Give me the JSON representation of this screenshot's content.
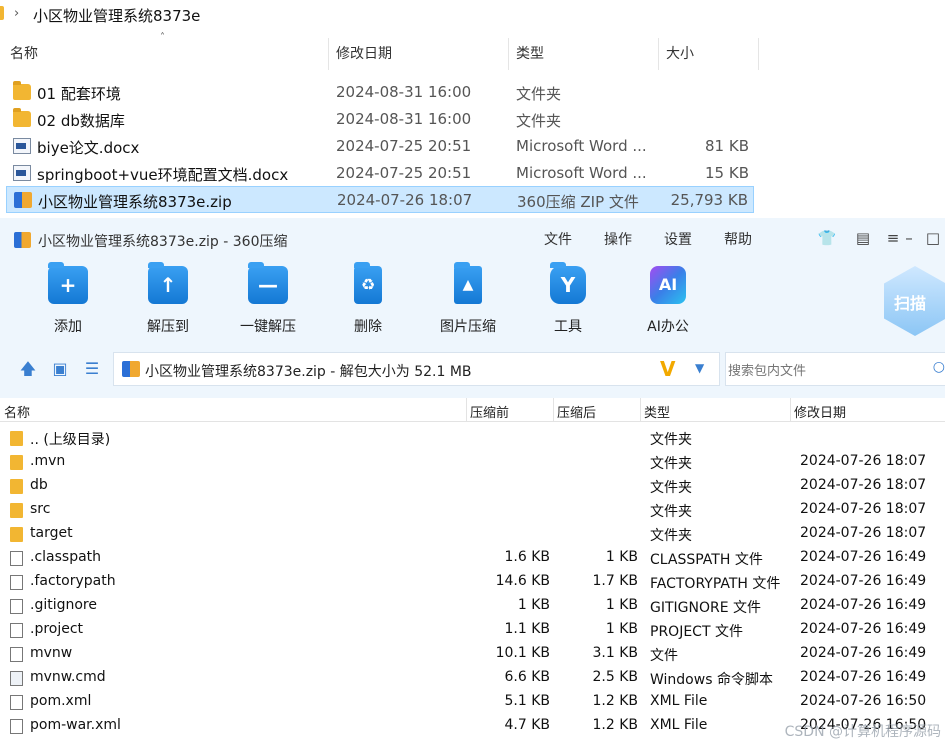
{
  "explorer": {
    "path": "小区物业管理系统8373e",
    "columns": {
      "name": "名称",
      "modified": "修改日期",
      "type": "类型",
      "size": "大小"
    },
    "rows": [
      {
        "name": "01 配套环境",
        "modified": "2024-08-31 16:00",
        "type": "文件夹",
        "size": "",
        "icon": "folder-icon"
      },
      {
        "name": "02 db数据库",
        "modified": "2024-08-31 16:00",
        "type": "文件夹",
        "size": "",
        "icon": "folder-icon"
      },
      {
        "name": "biye论文.docx",
        "modified": "2024-07-25 20:51",
        "type": "Microsoft Word ...",
        "size": "81 KB",
        "icon": "word-doc-icon"
      },
      {
        "name": "springboot+vue环境配置文档.docx",
        "modified": "2024-07-25 20:51",
        "type": "Microsoft Word ...",
        "size": "15 KB",
        "icon": "word-doc-icon"
      },
      {
        "name": "小区物业管理系统8373e.zip",
        "modified": "2024-07-26 18:07",
        "type": "360压缩 ZIP 文件",
        "size": "25,793 KB",
        "icon": "zip-icon"
      }
    ]
  },
  "zip_window": {
    "title": "小区物业管理系统8373e.zip - 360压缩",
    "menu": [
      "文件",
      "操作",
      "设置",
      "帮助"
    ],
    "toolbar": [
      {
        "label": "添加",
        "icon": "add-icon"
      },
      {
        "label": "解压到",
        "icon": "extract-to-icon"
      },
      {
        "label": "一键解压",
        "icon": "one-click-extract-icon"
      },
      {
        "label": "删除",
        "icon": "delete-icon"
      },
      {
        "label": "图片压缩",
        "icon": "image-compress-icon"
      },
      {
        "label": "工具",
        "icon": "tools-icon"
      },
      {
        "label": "AI办公",
        "icon": "ai-office-icon"
      }
    ],
    "scan_label": "扫描",
    "address": "小区物业管理系统8373e.zip - 解包大小为 52.1 MB",
    "search_placeholder": "搜索包内文件",
    "columns": {
      "name": "名称",
      "before": "压缩前",
      "after": "压缩后",
      "type": "类型",
      "modified": "修改日期"
    },
    "files": [
      {
        "name": ".. (上级目录)",
        "before": "",
        "after": "",
        "type": "文件夹",
        "modified": "",
        "kind": "folder"
      },
      {
        "name": ".mvn",
        "before": "",
        "after": "",
        "type": "文件夹",
        "modified": "2024-07-26 18:07",
        "kind": "folder"
      },
      {
        "name": "db",
        "before": "",
        "after": "",
        "type": "文件夹",
        "modified": "2024-07-26 18:07",
        "kind": "folder"
      },
      {
        "name": "src",
        "before": "",
        "after": "",
        "type": "文件夹",
        "modified": "2024-07-26 18:07",
        "kind": "folder"
      },
      {
        "name": "target",
        "before": "",
        "after": "",
        "type": "文件夹",
        "modified": "2024-07-26 18:07",
        "kind": "folder"
      },
      {
        "name": ".classpath",
        "before": "1.6 KB",
        "after": "1 KB",
        "type": "CLASSPATH 文件",
        "modified": "2024-07-26 16:49",
        "kind": "file"
      },
      {
        "name": ".factorypath",
        "before": "14.6 KB",
        "after": "1.7 KB",
        "type": "FACTORYPATH 文件",
        "modified": "2024-07-26 16:49",
        "kind": "file"
      },
      {
        "name": ".gitignore",
        "before": "1 KB",
        "after": "1 KB",
        "type": "GITIGNORE 文件",
        "modified": "2024-07-26 16:49",
        "kind": "file"
      },
      {
        "name": ".project",
        "before": "1.1 KB",
        "after": "1 KB",
        "type": "PROJECT 文件",
        "modified": "2024-07-26 16:49",
        "kind": "file"
      },
      {
        "name": "mvnw",
        "before": "10.1 KB",
        "after": "3.1 KB",
        "type": "文件",
        "modified": "2024-07-26 16:49",
        "kind": "file"
      },
      {
        "name": "mvnw.cmd",
        "before": "6.6 KB",
        "after": "2.5 KB",
        "type": "Windows 命令脚本",
        "modified": "2024-07-26 16:49",
        "kind": "cmd"
      },
      {
        "name": "pom.xml",
        "before": "5.1 KB",
        "after": "1.2 KB",
        "type": "XML File",
        "modified": "2024-07-26 16:50",
        "kind": "file"
      },
      {
        "name": "pom-war.xml",
        "before": "4.7 KB",
        "after": "1.2 KB",
        "type": "XML File",
        "modified": "2024-07-26 16:50",
        "kind": "file"
      }
    ]
  },
  "watermark": "CSDN @计算机程序源码"
}
